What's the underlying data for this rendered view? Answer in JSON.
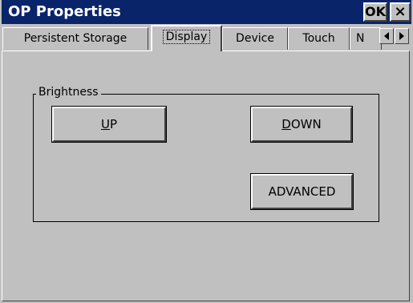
{
  "window": {
    "title": "OP Properties",
    "ok_label": "OK",
    "close_label": "×"
  },
  "tabs": [
    {
      "label": "Persistent Storage",
      "active": false
    },
    {
      "label": "Display",
      "active": true
    },
    {
      "label": "Device",
      "active": false
    },
    {
      "label": "Touch",
      "active": false
    },
    {
      "label": "N",
      "active": false
    }
  ],
  "tab_scroll": {
    "left_icon": "arrow-left-icon",
    "right_icon": "arrow-right-icon"
  },
  "brightness": {
    "group_label": "Brightness",
    "up": {
      "mnemonic": "U",
      "rest": "P"
    },
    "down": {
      "mnemonic": "D",
      "rest": "OWN"
    },
    "advanced_label": "ADVANCED"
  },
  "colors": {
    "titlebar": "#0a246a",
    "face": "#c0c0c0"
  }
}
